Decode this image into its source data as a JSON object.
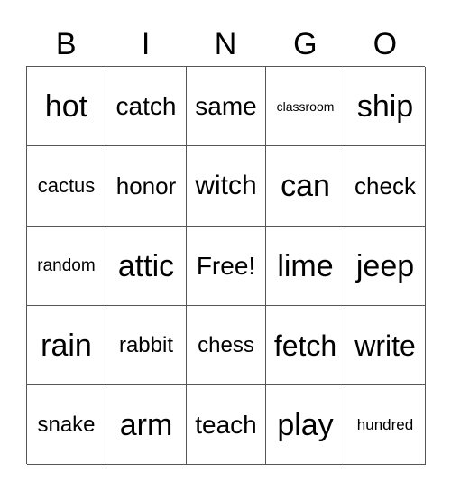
{
  "card": {
    "header": [
      "B",
      "I",
      "N",
      "G",
      "O"
    ],
    "rows": [
      [
        "hot",
        "catch",
        "same",
        "classroom",
        "ship"
      ],
      [
        "cactus",
        "honor",
        "witch",
        "can",
        "check"
      ],
      [
        "random",
        "attic",
        "Free!",
        "lime",
        "jeep"
      ],
      [
        "rain",
        "rabbit",
        "chess",
        "fetch",
        "write"
      ],
      [
        "snake",
        "arm",
        "teach",
        "play",
        "hundred"
      ]
    ]
  }
}
